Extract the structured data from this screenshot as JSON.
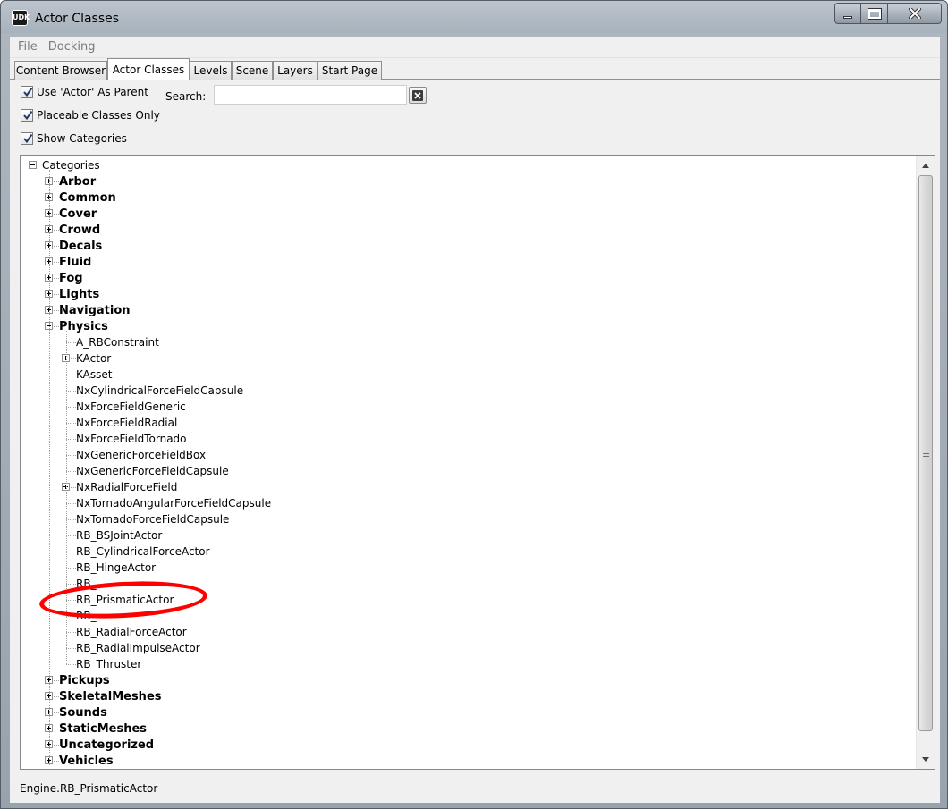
{
  "window": {
    "title": "Actor Classes",
    "app_icon_text": "UDK"
  },
  "menu": [
    "File",
    "Docking"
  ],
  "tabs": [
    {
      "label": "Content Browser",
      "active": false
    },
    {
      "label": "Actor Classes",
      "active": true
    },
    {
      "label": "Levels",
      "active": false
    },
    {
      "label": "Scene",
      "active": false
    },
    {
      "label": "Layers",
      "active": false
    },
    {
      "label": "Start Page",
      "active": false
    }
  ],
  "options": {
    "use_actor_parent": {
      "label": "Use 'Actor' As Parent",
      "checked": true
    },
    "placeable_only": {
      "label": "Placeable Classes Only",
      "checked": true
    },
    "show_categories": {
      "label": "Show Categories",
      "checked": true
    }
  },
  "search": {
    "label": "Search:",
    "value": "",
    "placeholder": ""
  },
  "tree": {
    "root": "Categories",
    "categories_before": [
      "Arbor",
      "Common",
      "Cover",
      "Crowd",
      "Decals",
      "Fluid",
      "Fog",
      "Lights",
      "Navigation"
    ],
    "open_category": "Physics",
    "physics_children": [
      {
        "label": "A_RBConstraint",
        "expandable": false
      },
      {
        "label": "KActor",
        "expandable": true
      },
      {
        "label": "KAsset",
        "expandable": false
      },
      {
        "label": "NxCylindricalForceFieldCapsule",
        "expandable": false
      },
      {
        "label": "NxForceFieldGeneric",
        "expandable": false
      },
      {
        "label": "NxForceFieldRadial",
        "expandable": false
      },
      {
        "label": "NxForceFieldTornado",
        "expandable": false
      },
      {
        "label": "NxGenericForceFieldBox",
        "expandable": false
      },
      {
        "label": "NxGenericForceFieldCapsule",
        "expandable": false
      },
      {
        "label": "NxRadialForceField",
        "expandable": true
      },
      {
        "label": "NxTornadoAngularForceFieldCapsule",
        "expandable": false
      },
      {
        "label": "NxTornadoForceFieldCapsule",
        "expandable": false
      },
      {
        "label": "RB_BSJointActor",
        "expandable": false
      },
      {
        "label": "RB_CylindricalForceActor",
        "expandable": false
      },
      {
        "label": "RB_HingeActor",
        "expandable": false
      },
      {
        "label": "RB_",
        "expandable": false
      },
      {
        "label": "RB_PrismaticActor",
        "expandable": false
      },
      {
        "label": "RB_",
        "expandable": false
      },
      {
        "label": "RB_RadialForceActor",
        "expandable": false
      },
      {
        "label": "RB_RadialImpulseActor",
        "expandable": false
      },
      {
        "label": "RB_Thruster",
        "expandable": false
      }
    ],
    "categories_after": [
      "Pickups",
      "SkeletalMeshes",
      "Sounds",
      "StaticMeshes",
      "Uncategorized",
      "Vehicles"
    ]
  },
  "status": {
    "text": "Engine.RB_PrismaticActor"
  },
  "annotation": {
    "color": "#ff0000",
    "target": "RB_PrismaticActor"
  }
}
